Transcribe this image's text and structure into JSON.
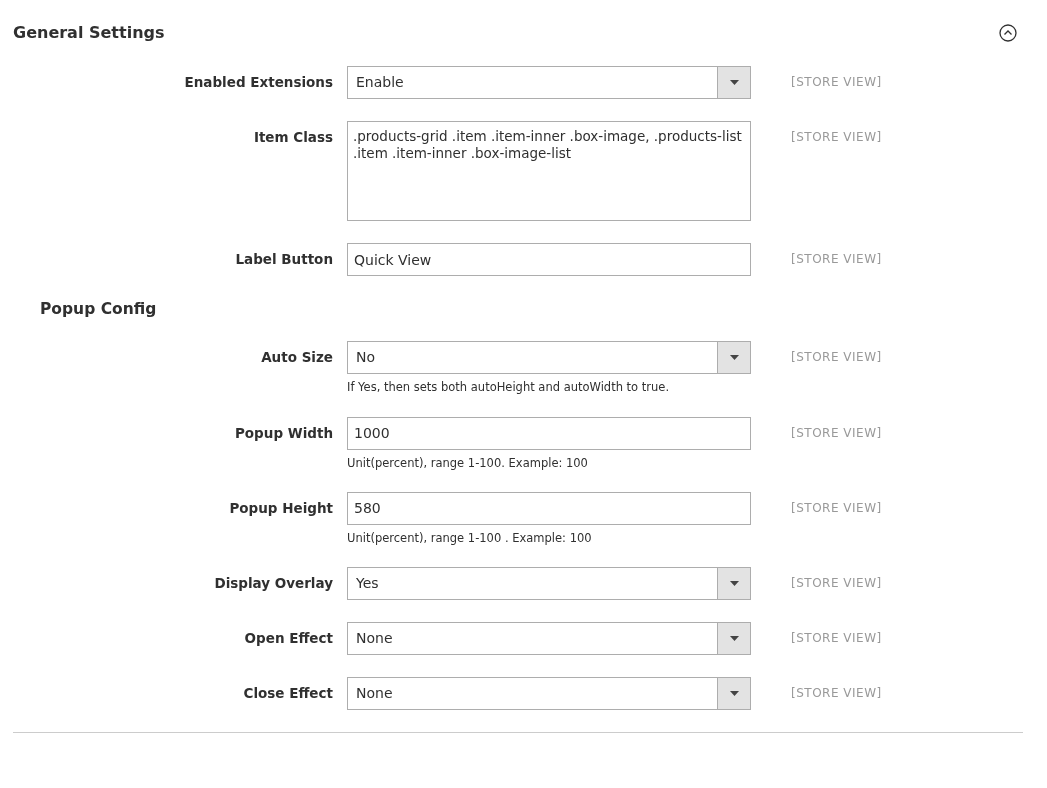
{
  "section": {
    "title": "General Settings",
    "expanded": true
  },
  "rows": [
    {
      "kind": "select",
      "label": "Enabled Extensions",
      "value": "Enable",
      "scope": "[STORE VIEW]"
    },
    {
      "kind": "textarea",
      "label": "Item Class",
      "value": ".products-grid .item .item-inner .box-image, .products-list .item .item-inner .box-image-list",
      "scope": "[STORE VIEW]"
    },
    {
      "kind": "text",
      "label": "Label Button",
      "value": "Quick View",
      "scope": "[STORE VIEW]"
    },
    {
      "kind": "heading",
      "label": "Popup Config"
    },
    {
      "kind": "select",
      "label": "Auto Size",
      "value": "No",
      "scope": "[STORE VIEW]",
      "note": "If Yes, then sets both autoHeight and autoWidth to true."
    },
    {
      "kind": "text",
      "label": "Popup Width",
      "value": "1000",
      "scope": "[STORE VIEW]",
      "note": "Unit(percent), range 1-100. Example: 100"
    },
    {
      "kind": "text",
      "label": "Popup Height",
      "value": "580",
      "scope": "[STORE VIEW]",
      "note": "Unit(percent), range 1-100 . Example: 100"
    },
    {
      "kind": "select",
      "label": "Display Overlay",
      "value": "Yes",
      "scope": "[STORE VIEW]"
    },
    {
      "kind": "select",
      "label": "Open Effect",
      "value": "None",
      "scope": "[STORE VIEW]"
    },
    {
      "kind": "select",
      "label": "Close Effect",
      "value": "None",
      "scope": "[STORE VIEW]"
    }
  ]
}
